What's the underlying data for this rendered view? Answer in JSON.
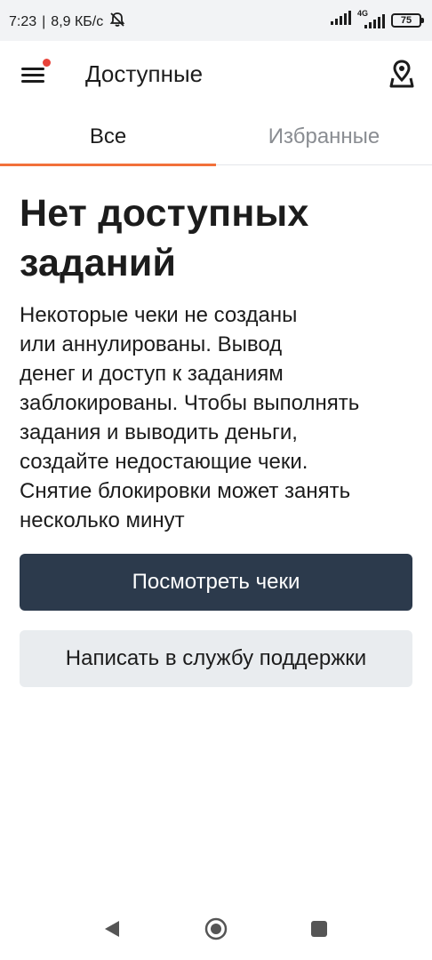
{
  "status_bar": {
    "time": "7:23",
    "separator": "|",
    "speed": "8,9 КБ/с",
    "network": "4G",
    "battery": "75"
  },
  "app_bar": {
    "title": "Доступные",
    "menu_icon": "hamburger-menu-icon",
    "notification_dot_color": "#e8433a",
    "location_icon": "location-pin-icon"
  },
  "tabs": [
    {
      "label": "Все",
      "active": true
    },
    {
      "label": "Избранные",
      "active": false
    }
  ],
  "accent_color": "#f2703a",
  "main": {
    "heading": "Нет доступных заданий",
    "description": "Некоторые чеки не созданы\nили аннулированы. Вывод\nденег и доступ к заданиям\nзаблокированы. Чтобы выполнять\nзадания и выводить деньги,\nсоздайте недостающие чеки.\nСнятие блокировки может занять\nнесколько минут",
    "primary_button": {
      "label": "Посмотреть чеки",
      "color": "#2c3a4c"
    },
    "secondary_button": {
      "label": "Написать в службу поддержки",
      "color": "#e9ecef"
    }
  },
  "nav_bar": {
    "back_icon": "back-triangle-icon",
    "home_icon": "home-circle-icon",
    "recent_icon": "recent-apps-square-icon"
  }
}
